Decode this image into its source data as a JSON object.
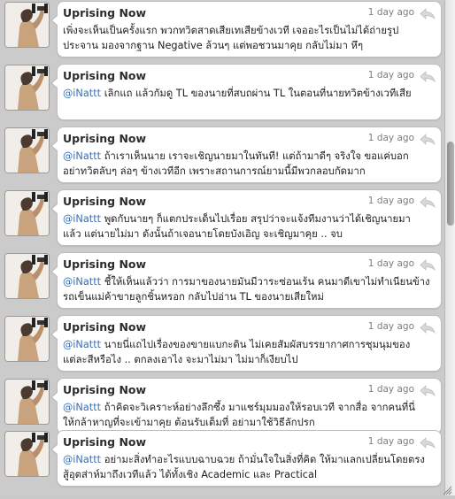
{
  "tweets": [
    {
      "user": "Uprising Now",
      "time": "1 day ago",
      "mention": "",
      "line1": "เพิ่งจะเห็นเป็นครั้งแรก พวกทวิตสาดเสียเทเสียข้างเวที เจออะไรเป็นไม่ได้ถ่ายรูป",
      "line2": "ประจาน มองจากฐาน Negative ล้วนๆ แต่พอชวนมาคุย กลับไม่มา หึๆ"
    },
    {
      "user": "Uprising Now",
      "time": "1 day ago",
      "mention": "@iNattt",
      "line1": " เลิกแถ แล้วกัมดู TL ของนายที่สบถผ่าน TL ในตอนที่นายทวิตข้างเวทีเสีย",
      "line2": ""
    },
    {
      "user": "Uprising Now",
      "time": "1 day ago",
      "mention": "@iNattt",
      "line1": " ถ้าเราเห็นนาย เราจะเชิญนายมาในทันที! แต่ถ้ามาดีๆ จริงใจ ขอแค่บอก",
      "line2": "อย่าทวิตลับๆ ล่อๆ ข้างเวทีอีก เพราะสถานการณ์ยามนี้มีพวกลอบกัดมาก"
    },
    {
      "user": "Uprising Now",
      "time": "1 day ago",
      "mention": "@iNattt",
      "line1": " พูดกับนายๆ ก็แตกประเด็นไปเรื่อย สรุปว่าจะแจ้งทีมงานว่าได้เชิญนายมา",
      "line2": "แล้ว แต่นายไม่มา ดังนั้นถ้าเจอนายโดยบังเอิญ จะเชิญมาคุย .. จบ"
    },
    {
      "user": "Uprising Now",
      "time": "1 day ago",
      "mention": "@iNattt",
      "line1": " ชี้ให้เห็นแล้วว่า การมาของนายมันมีวาระซ่อนเร้น คนมาดีเขาไม่ทำเนียนข้าง",
      "line2": "รถเข็นแม่ค้าขายลูกชิ้นหรอก กลับไปอ่าน TL ของนายเสียใหม่"
    },
    {
      "user": "Uprising Now",
      "time": "1 day ago",
      "mention": "@iNattt",
      "line1": " นายนี่แถไปเรื่องของขายแบกะดิน ไม่เคยสัมผัสบรรยากาศการชุมนุมของ",
      "line2": "แต่ละสีหรือไง .. ตกลงเอาไง จะมาไม่มา ไม่มาก็เงียบไป"
    },
    {
      "user": "Uprising Now",
      "time": "1 day ago",
      "mention": "@iNattt",
      "line1": " ถ้าคิดจะวิเคราะห์อย่างลึกซึ้ง มาแชร์มุมมองให้รอบเวที จากสื่อ จากคนที่นี่",
      "line2": "ให้กล้าหาญที่จะเข้ามาคุย ต้อนรับเต็มที่ อย่ามาใช้วิธีลักปรก"
    },
    {
      "user": "Uprising Now",
      "time": "1 day ago",
      "mention": "@iNattt",
      "line1": " อย่ามะสิ่งทำอะไรแบบฉาบฉวย ถ้ามั่นใจในสิ่งที่คิด ให้มาแลกเปลี่ยนโดยตรง",
      "line2": "สู้อุตส่าห์มาถึงเวทีแล้ว ได้ทั้งเชิง Academic และ Practical"
    }
  ],
  "icons": {
    "reply": "reply-arrow-icon",
    "avatar": "avatar"
  }
}
